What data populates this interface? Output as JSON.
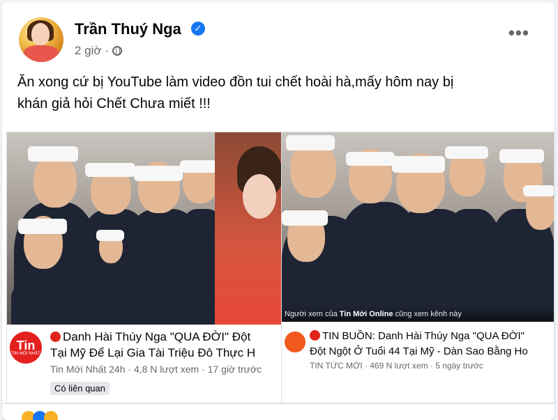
{
  "post": {
    "author": "Trần Thuý Nga",
    "verified": true,
    "time": "2 giờ",
    "dot": "·",
    "privacy_icon": "globe-icon",
    "more_icon": "more-options-icon",
    "more_label": "•••",
    "caption_line1": "Ăn xong cứ bị YouTube làm video đồn tui chết hoài hà,mấy hôm nay bị",
    "caption_line2": "khán giả hỏi Chết Chưa miết !!!"
  },
  "cards": [
    {
      "channel_logo_text": "Tin",
      "channel_logo_small": "TIN MỚI NHẤT",
      "title_line1": "Danh Hài Thúy Nga \"QUA ĐỜI\" Đột",
      "title_line2": "Tại Mỹ Để Lại Gia  Tài Triệu Đô Thực H",
      "channel": "Tin Mới Nhất 24h",
      "views": "4,8 N lượt xem",
      "age": "17 giờ trước",
      "related": "Có liên quan"
    },
    {
      "watermark_prefix": "Người xem của",
      "watermark_channel": "Tin Mới Online",
      "watermark_suffix": "cũng xem kênh này",
      "title_line1": "TIN BUỒN: Danh Hài Thúy Nga \"QUA ĐỜI\"",
      "title_line2": "Đột Ngột Ở Tuổi 44 Tại Mỹ - Dàn Sao Bằng Ho",
      "channel": "TIN TỨC MỚI",
      "views": "469 N lượt xem",
      "age": "5 ngày trước"
    }
  ],
  "colors": {
    "verified": "#1877f2",
    "live_dot": "#e0241b",
    "tin_logo": "#e4201f"
  }
}
